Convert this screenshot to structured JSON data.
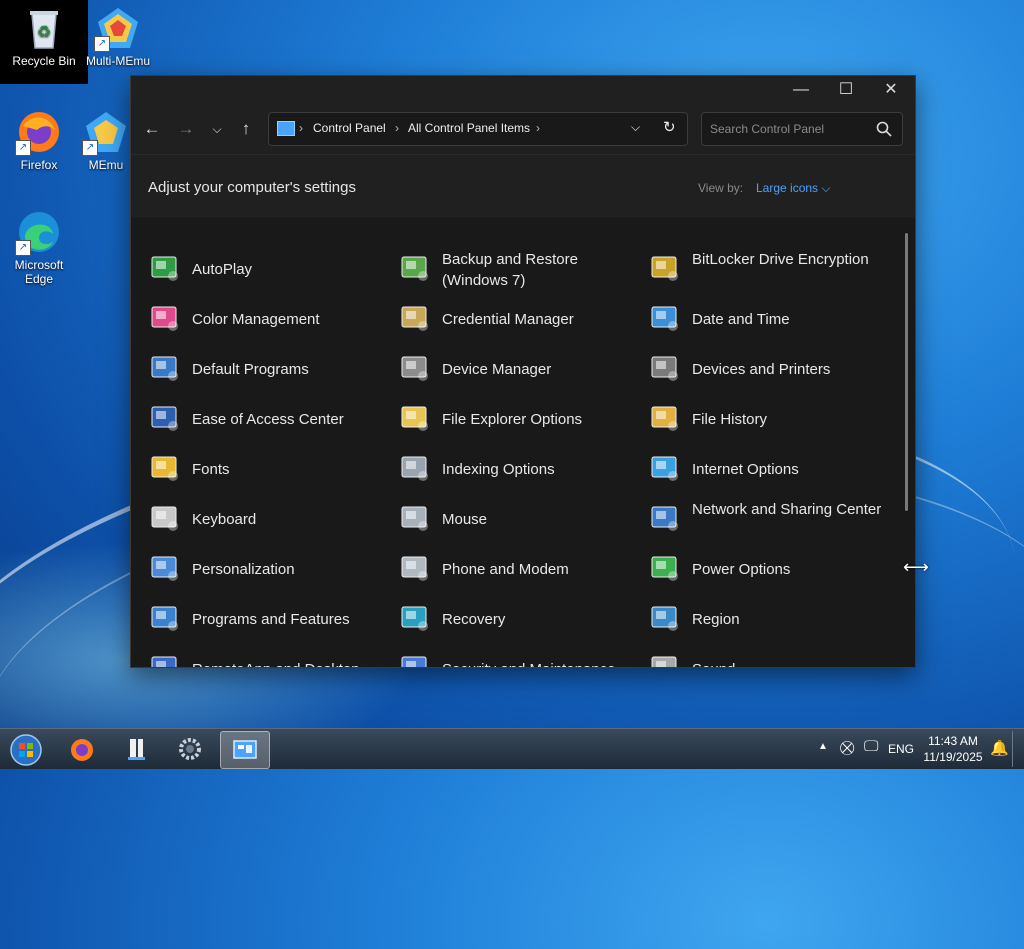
{
  "desktop": {
    "icons": [
      {
        "label": "Recycle Bin"
      },
      {
        "label": "Multi-MEmu"
      },
      {
        "label": "Firefox"
      },
      {
        "label": "MEmu"
      },
      {
        "label": "Microsoft Edge"
      }
    ]
  },
  "window": {
    "breadcrumbs": [
      "Control Panel",
      "All Control Panel Items"
    ],
    "search_placeholder": "Search Control Panel",
    "header_title": "Adjust your computer's settings",
    "view_by_label": "View by:",
    "view_by_value": "Large icons",
    "items": [
      {
        "label": "AutoPlay",
        "icon": "autoplay-icon"
      },
      {
        "label": "Backup and Restore (Windows 7)",
        "icon": "backup-restore-icon"
      },
      {
        "label": "BitLocker Drive Encryption",
        "icon": "bitlocker-icon"
      },
      {
        "label": "Color Management",
        "icon": "color-management-icon"
      },
      {
        "label": "Credential Manager",
        "icon": "credential-manager-icon"
      },
      {
        "label": "Date and Time",
        "icon": "date-time-icon"
      },
      {
        "label": "Default Programs",
        "icon": "default-programs-icon"
      },
      {
        "label": "Device Manager",
        "icon": "device-manager-icon"
      },
      {
        "label": "Devices and Printers",
        "icon": "devices-printers-icon"
      },
      {
        "label": "Ease of Access Center",
        "icon": "ease-of-access-icon"
      },
      {
        "label": "File Explorer Options",
        "icon": "file-explorer-options-icon"
      },
      {
        "label": "File History",
        "icon": "file-history-icon"
      },
      {
        "label": "Fonts",
        "icon": "fonts-icon"
      },
      {
        "label": "Indexing Options",
        "icon": "indexing-options-icon"
      },
      {
        "label": "Internet Options",
        "icon": "internet-options-icon"
      },
      {
        "label": "Keyboard",
        "icon": "keyboard-icon"
      },
      {
        "label": "Mouse",
        "icon": "mouse-icon"
      },
      {
        "label": "Network and Sharing Center",
        "icon": "network-sharing-icon"
      },
      {
        "label": "Personalization",
        "icon": "personalization-icon"
      },
      {
        "label": "Phone and Modem",
        "icon": "phone-modem-icon"
      },
      {
        "label": "Power Options",
        "icon": "power-options-icon"
      },
      {
        "label": "Programs and Features",
        "icon": "programs-features-icon"
      },
      {
        "label": "Recovery",
        "icon": "recovery-icon"
      },
      {
        "label": "Region",
        "icon": "region-icon"
      },
      {
        "label": "RemoteApp and Desktop",
        "icon": "remoteapp-icon"
      },
      {
        "label": "Security and Maintenance",
        "icon": "security-maintenance-icon"
      },
      {
        "label": "Sound",
        "icon": "sound-icon"
      }
    ]
  },
  "taskbar": {
    "language": "ENG",
    "time": "11:43 AM",
    "date": "11/19/2025"
  }
}
